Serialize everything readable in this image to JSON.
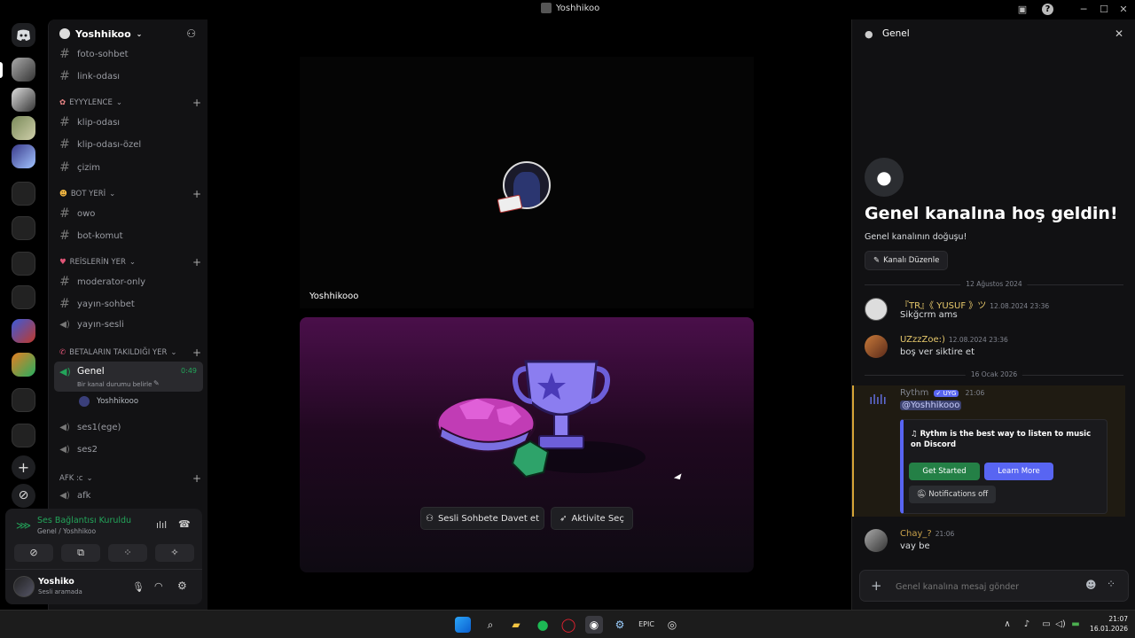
{
  "window": {
    "title": "Yoshhikoo"
  },
  "guild": {
    "name": "Yoshhikoo"
  },
  "channels": {
    "top": [
      {
        "name": "foto-sohbet"
      },
      {
        "name": "link-odası"
      }
    ],
    "cat1": {
      "name": "EYYYLENCE",
      "items": [
        {
          "name": "klip-odası"
        },
        {
          "name": "klip-odası-özel"
        },
        {
          "name": "çizim"
        }
      ]
    },
    "cat2": {
      "name": "BOT YERİ",
      "items": [
        {
          "name": "owo"
        },
        {
          "name": "bot-komut"
        }
      ]
    },
    "cat3": {
      "name": "REİSLERİN YER",
      "items": [
        {
          "name": "moderator-only"
        },
        {
          "name": "yayın-sohbet"
        },
        {
          "name": "yayın-sesli"
        }
      ]
    },
    "cat4": {
      "name": "BETALARIN TAKILDIĞI YER",
      "active": {
        "name": "Genel",
        "timer": "0:49",
        "status": "Bir kanal durumu belirle",
        "member": "Yoshhikooo"
      },
      "items": [
        {
          "name": "ses1(ege)"
        },
        {
          "name": "ses2"
        }
      ]
    },
    "cat5": {
      "name": "AFK :c",
      "items": [
        {
          "name": "afk"
        }
      ]
    }
  },
  "voice": {
    "status": "Ses Bağlantısı Kuruldu",
    "location": "Genel / Yoshhikoo"
  },
  "user": {
    "name": "Yoshiko",
    "status": "Sesli aramada"
  },
  "stage": {
    "participant": "Yoshhikooo",
    "invite_button": "Sesli Sohbete Davet et",
    "activity_button": "Aktivite Seç"
  },
  "chat": {
    "header": "Genel",
    "welcome_title": "Genel kanalına hoş geldin!",
    "welcome_sub": "Genel kanalının doğuşu!",
    "edit_button": "Kanalı Düzenle",
    "date1": "12 Ağustos 2024",
    "date2": "16 Ocak 2026",
    "messages": [
      {
        "user": "『TR』《 YUSUF 》ツ",
        "time": "12.08.2024 23:36",
        "text": "Sikğcrm ams",
        "color": "#e6c86b"
      },
      {
        "user": "UZzzZoe:)",
        "time": "12.08.2024 23:36",
        "text": "boş ver siktire et",
        "color": "#e6c86b"
      },
      {
        "user": "Chay_?",
        "time": "21:06",
        "text": "vay be",
        "color": "#c9a24b"
      }
    ],
    "bot": {
      "user": "Rythm",
      "tag": "UYG",
      "time": "21:06",
      "mention": "@Yoshhikooo",
      "embed_text": "Rythm is the best way to listen to music on Discord",
      "btn_start": "Get Started",
      "btn_learn": "Learn More",
      "btn_notif": "Notifications off"
    },
    "input_placeholder": "Genel kanalına mesaj gönder"
  },
  "taskbar": {
    "time": "21:07",
    "date": "16.01.2026"
  }
}
